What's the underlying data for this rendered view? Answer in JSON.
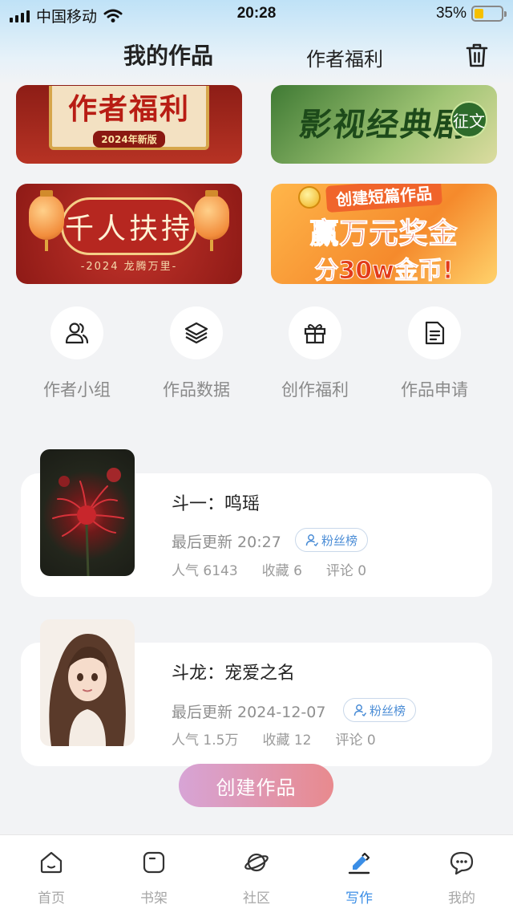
{
  "status": {
    "carrier": "中国移动",
    "time": "20:28",
    "battery": "35%",
    "battery_level": 0.35
  },
  "header": {
    "tab_active": "我的作品",
    "tab_other": "作者福利"
  },
  "banners": {
    "b1_title": "作者福利",
    "b1_sub": "2024年新版",
    "b2_title": "影视经典剧",
    "b2_seal": "征文",
    "b3_title": "千人扶持",
    "b3_sub": "-2024 龙腾万里-",
    "b4_l1": "创建短篇作品",
    "b4_l2": "赢万元奖金",
    "b4_l3": "分30w金币!"
  },
  "quick_actions": [
    {
      "label": "作者小组",
      "icon": "group-icon"
    },
    {
      "label": "作品数据",
      "icon": "layers-icon"
    },
    {
      "label": "创作福利",
      "icon": "gift-icon"
    },
    {
      "label": "作品申请",
      "icon": "document-icon"
    }
  ],
  "works": [
    {
      "title": "斗一：鸣瑶",
      "updated": "最后更新 20:27",
      "fans": "粉丝榜",
      "popularity": "人气 6143",
      "favorites": "收藏 6",
      "comments": "评论 0"
    },
    {
      "title": "斗龙：宠爱之名",
      "updated": "最后更新 2024-12-07",
      "fans": "粉丝榜",
      "popularity": "人气 1.5万",
      "favorites": "收藏 12",
      "comments": "评论 0"
    }
  ],
  "create_button": "创建作品",
  "tabbar": [
    {
      "label": "首页",
      "icon": "home-icon"
    },
    {
      "label": "书架",
      "icon": "bookshelf-icon"
    },
    {
      "label": "社区",
      "icon": "planet-icon"
    },
    {
      "label": "写作",
      "icon": "pen-icon",
      "active": true
    },
    {
      "label": "我的",
      "icon": "chat-icon"
    }
  ],
  "colors": {
    "accent": "#3b8ee6",
    "create_start": "#d7a4d6",
    "create_end": "#e88a8e"
  }
}
